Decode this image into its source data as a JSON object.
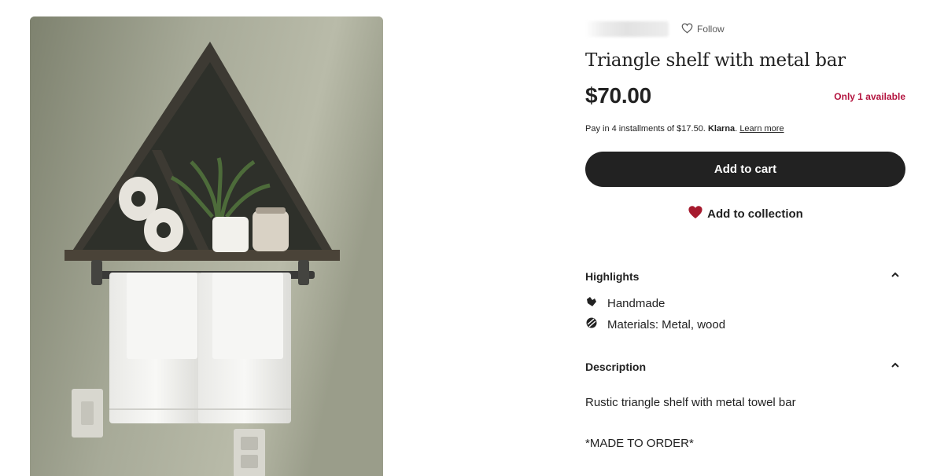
{
  "listing": {
    "follow_label": "Follow",
    "title": "Triangle shelf with metal bar",
    "price": "$70.00",
    "availability": "Only 1 available",
    "installments": {
      "prefix": "Pay in 4 installments of $17.50.",
      "provider": "Klarna",
      "separator": ".",
      "learn_more": "Learn more"
    },
    "add_to_cart_label": "Add to cart",
    "add_to_collection_label": "Add to collection"
  },
  "highlights": {
    "heading": "Highlights",
    "items": [
      {
        "icon": "handmade-icon",
        "text": "Handmade"
      },
      {
        "icon": "materials-icon",
        "text": "Materials: Metal, wood"
      }
    ]
  },
  "description": {
    "heading": "Description",
    "lines": [
      "Rustic triangle shelf with metal towel bar",
      "*MADE TO ORDER*"
    ]
  },
  "colors": {
    "text": "#222222",
    "availability": "#b3133e",
    "button": "#222222",
    "heart": "#a61a2e"
  }
}
